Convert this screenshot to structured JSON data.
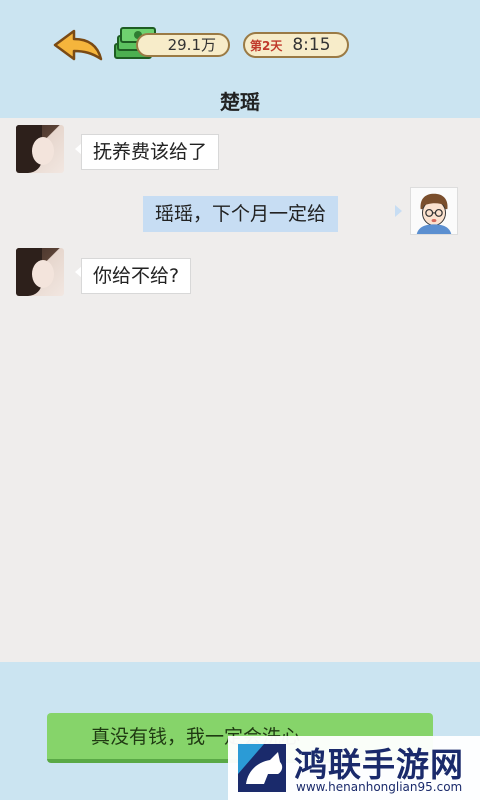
{
  "header": {
    "money": "29.1万",
    "day": "第2天",
    "time": "8:15",
    "title": "楚瑶"
  },
  "messages": [
    {
      "sender": "楚瑶",
      "side": "left",
      "text": "抚养费该给了"
    },
    {
      "sender": "me",
      "side": "right",
      "text": "瑶瑶，下个月一定给"
    },
    {
      "sender": "楚瑶",
      "side": "left",
      "text": "你给不给?"
    }
  ],
  "reply_option": {
    "label": "真没有钱，我一定会洗心"
  },
  "watermark": {
    "title": "鸿联手游网",
    "url": "www.henanhonglian95.com"
  },
  "icons": {
    "back": "back-arrow-icon",
    "money": "cash-stack-icon"
  },
  "colors": {
    "top_bar": "#cbe4f1",
    "chat_bg": "#efedec",
    "reply_button": "#86d46a",
    "my_bubble": "#c7ddf3"
  }
}
